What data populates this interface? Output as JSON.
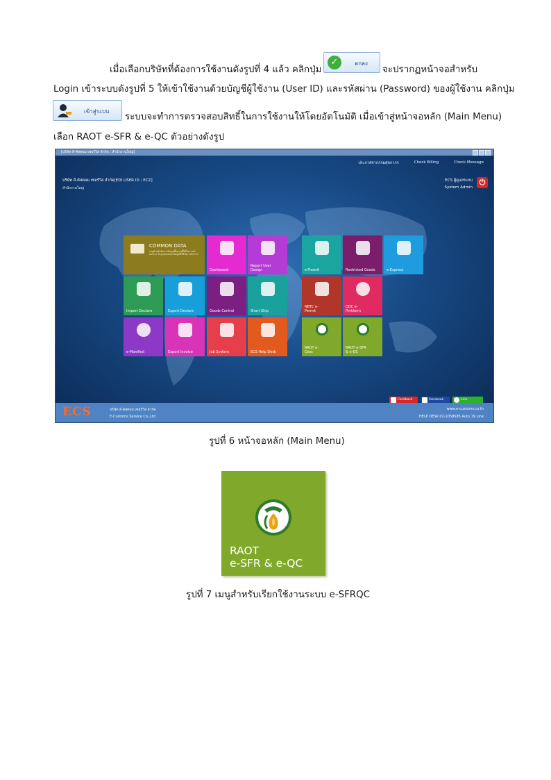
{
  "paragraph": {
    "line1_before": "เมื่อเลือกบริษัทที่ต้องการใช้งานดังรูปที่ 4 แล้ว คลิกปุ่ม",
    "line1_after": "จะปรากฏหน้าจอสำหรับ",
    "line2": "Login เข้าระบบดังรูปที่ 5 ให้เข้าใช้งานด้วยบัญชีผู้ใช้งาน (User ID) และรหัสผ่าน (Password) ของผู้ใช้งาน คลิกปุ่ม",
    "line3_after": "ระบบจะทำการตรวจสอบสิทธิ์ในการใช้งานให้โดยอัตโนมัติ เมื่อเข้าสู่หน้าจอหลัก (Main Menu)",
    "line4": "เลือก RAOT e-SFR & e-QC ตัวอย่างดังรูป",
    "ok_button_label": "ตกลง",
    "login_button_label": "เข้าสู่ระบบ"
  },
  "screenshot": {
    "title": "[บริษัท อี-คัสตอม เซอร์วิส จำกัด : สำนักงานใหญ่]",
    "top_links": [
      "ประกาศจากกรมศุลกากร",
      "Check Billing",
      "Check Message"
    ],
    "company": "บริษัท อี-คัสตอม เซอร์วิส จำกัด[EDI USER ID : ECZ]",
    "branch": "สำนักงานใหญ่",
    "user_name": "ECS ผู้ดูแลระบบ",
    "user_role": "System Admin",
    "common_data_title": "COMMON DATA",
    "common_data_desc": "เมนูสำหรับจัดการข้อมูลพื้นฐานที่ใช้ในการทำเอกสาร ในรูปแบบของ ข้อมูลที่ใช้ในการทำงาน",
    "tiles": [
      {
        "label": "Dashboard",
        "color": "#e42ad0"
      },
      {
        "label": "Report User Design",
        "color": "#b53bd6"
      },
      {
        "label": "e-Transit",
        "color": "#1aa5a0"
      },
      {
        "label": "Restricted Goods",
        "color": "#7a1d6b"
      },
      {
        "label": "e-Express",
        "color": "#1f9be0"
      },
      {
        "label": "Import Declare",
        "color": "#2d9a55"
      },
      {
        "label": "Export Declare",
        "color": "#169fd8"
      },
      {
        "label": "Goods Control",
        "color": "#7c1f82"
      },
      {
        "label": "Short Ship",
        "color": "#1ba19c"
      },
      {
        "label": "NBTC e-Permit",
        "color": "#b2352a"
      },
      {
        "label": "DDC e-Pinkform",
        "color": "#e02a62"
      },
      {
        "label": "e-Manifest",
        "color": "#8c39c8"
      },
      {
        "label": "Export Invoice",
        "color": "#d934b8"
      },
      {
        "label": "Job System",
        "color": "#e63e4b"
      },
      {
        "label": "ECS Help Desk",
        "color": "#e35a1f"
      },
      {
        "label": "RAOT e-Cess",
        "color": "#80a92b"
      },
      {
        "label": "RAOT e-SFR & e-QC",
        "color": "#80a92b"
      }
    ],
    "social": [
      "Feedback",
      "Facebook",
      "Line"
    ],
    "footer_company_th": "บริษัท อี-คัสตอม เซอร์วิส จำกัด",
    "footer_company_en": "E-Customs Service Co.,Ltd",
    "footer_logo": "ECS",
    "footer_web": "www.e-customs.co.th",
    "footer_helpdesk": "HELP DESK 02-1058585 Auto 19 Line"
  },
  "caption6": "รูปที่ 6 หน้าจอหลัก (Main Menu)",
  "big_tile": {
    "line1": "RAOT",
    "line2": "e-SFR & e-QC",
    "color": "#80a92b"
  },
  "caption7": "รูปที่ 7 เมนูสำหรับเรียกใช้งานระบบ e-SFRQC"
}
